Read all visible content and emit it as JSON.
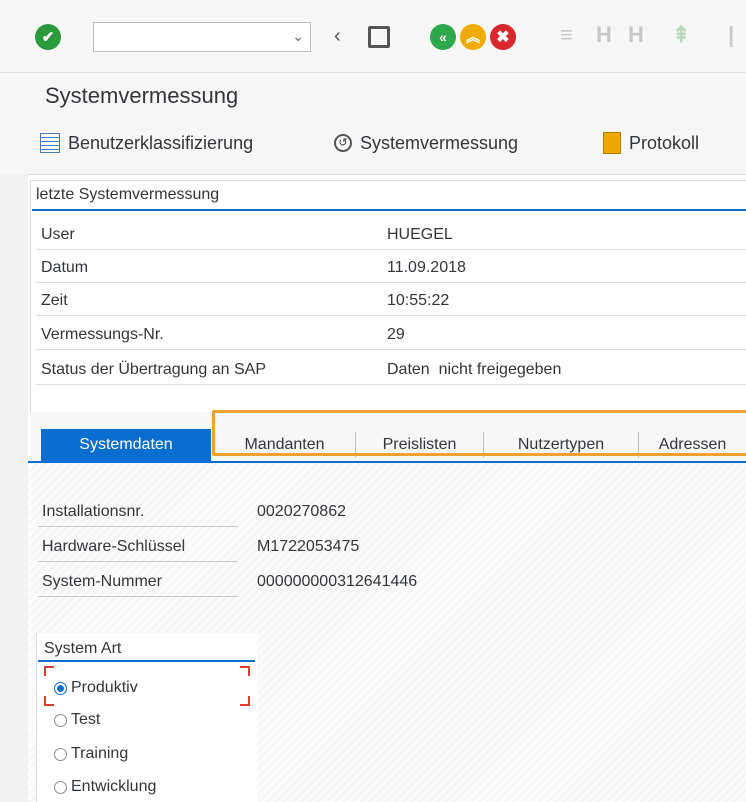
{
  "toolbar": {
    "command_value": "",
    "icons": [
      "check-icon",
      "dropdown-icon",
      "back-icon",
      "save-icon",
      "back-green-icon",
      "exit-icon",
      "cancel-icon",
      "print-icon",
      "find-icon",
      "find-next-icon",
      "first-page-icon"
    ],
    "colors": {
      "green": "#2ea84d",
      "orange": "#f0ab00",
      "red": "#d9272e"
    }
  },
  "title": "Systemvermessung",
  "app_toolbar": {
    "items": [
      "Benutzerklassifizierung",
      "Systemvermessung",
      "Protokoll"
    ]
  },
  "last_measurement": {
    "title": "letzte Systemvermessung",
    "rows": [
      {
        "label": "User",
        "value": "HUEGEL"
      },
      {
        "label": "Datum",
        "value": "11.09.2018"
      },
      {
        "label": "Zeit",
        "value": "10:55:22"
      },
      {
        "label": "Vermessungs-Nr.",
        "value": "29"
      },
      {
        "label": "Status der Übertragung an SAP",
        "value": "Daten  nicht freigegeben"
      }
    ]
  },
  "tabs": [
    "Systemdaten",
    "Mandanten",
    "Preislisten",
    "Nutzertypen",
    "Adressen"
  ],
  "system_data": {
    "rows": [
      {
        "label": "Installationsnr.",
        "value": "0020270862"
      },
      {
        "label": "Hardware-Schlüssel",
        "value": "M1722053475"
      },
      {
        "label": "System-Nummer",
        "value": "000000000312641446"
      }
    ]
  },
  "system_art": {
    "title": "System Art",
    "options": [
      "Produktiv",
      "Test",
      "Training",
      "Entwicklung"
    ],
    "selected": "Produktiv"
  },
  "accent": "#0a6ed1",
  "highlight_color": "#f0a22e"
}
